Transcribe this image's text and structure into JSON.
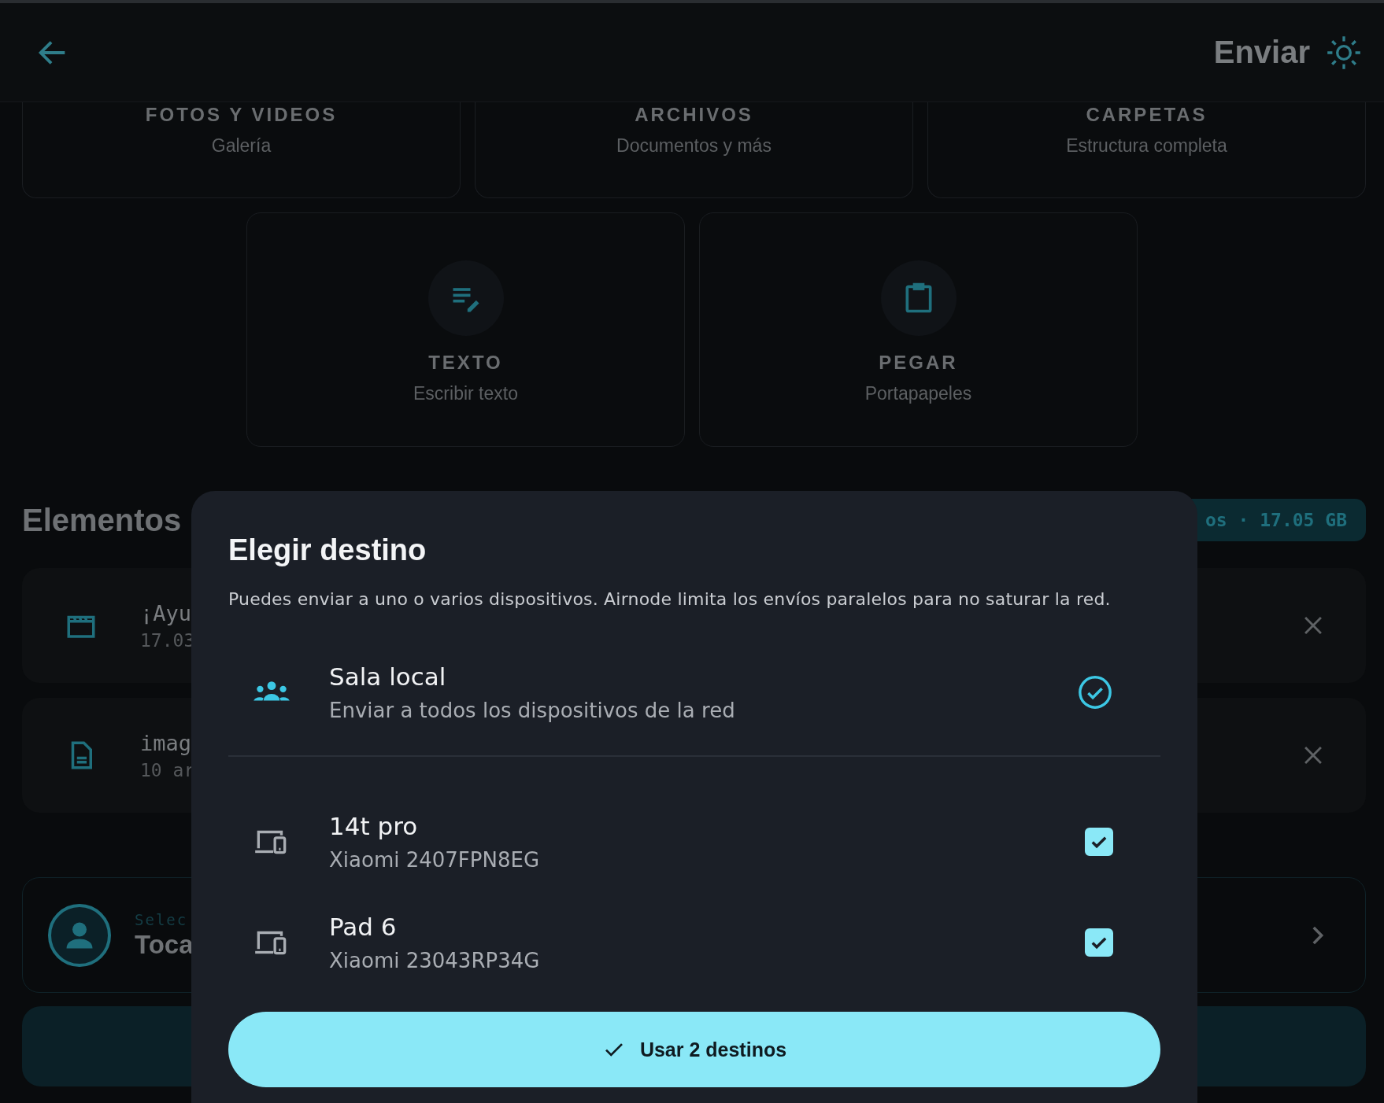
{
  "header": {
    "title": "Enviar"
  },
  "sources": [
    {
      "kind": "photos",
      "title": "FOTOS Y VIDEOS",
      "subtitle": "Galería"
    },
    {
      "kind": "files",
      "title": "ARCHIVOS",
      "subtitle": "Documentos y más"
    },
    {
      "kind": "folders",
      "title": "CARPETAS",
      "subtitle": "Estructura completa"
    },
    {
      "kind": "text",
      "title": "TEXTO",
      "subtitle": "Escribir texto"
    },
    {
      "kind": "clipboard",
      "title": "PEGAR",
      "subtitle": "Portapapeles"
    }
  ],
  "items_section": {
    "heading": "Elementos",
    "summary": "os · 17.05 GB"
  },
  "items": [
    {
      "kind": "video",
      "name": "¡Ayu",
      "meta": "17.03"
    },
    {
      "kind": "document",
      "name": "imag",
      "meta": "10 ar"
    }
  ],
  "recipient": {
    "caption": "Selec",
    "label": "Toca"
  },
  "dialog": {
    "title": "Elegir destino",
    "description": "Puedes enviar a uno o varios dispositivos. Airnode limita los envíos paralelos para no saturar la red.",
    "targets": [
      {
        "kind": "room",
        "name": "Sala local",
        "detail": "Enviar a todos los dispositivos de la red",
        "selected": true
      },
      {
        "kind": "device",
        "name": "14t pro",
        "detail": "Xiaomi 2407FPN8EG",
        "selected": true
      },
      {
        "kind": "device",
        "name": "Pad 6",
        "detail": "Xiaomi 23043RP34G",
        "selected": true
      }
    ],
    "confirm": "Usar 2 destinos"
  }
}
